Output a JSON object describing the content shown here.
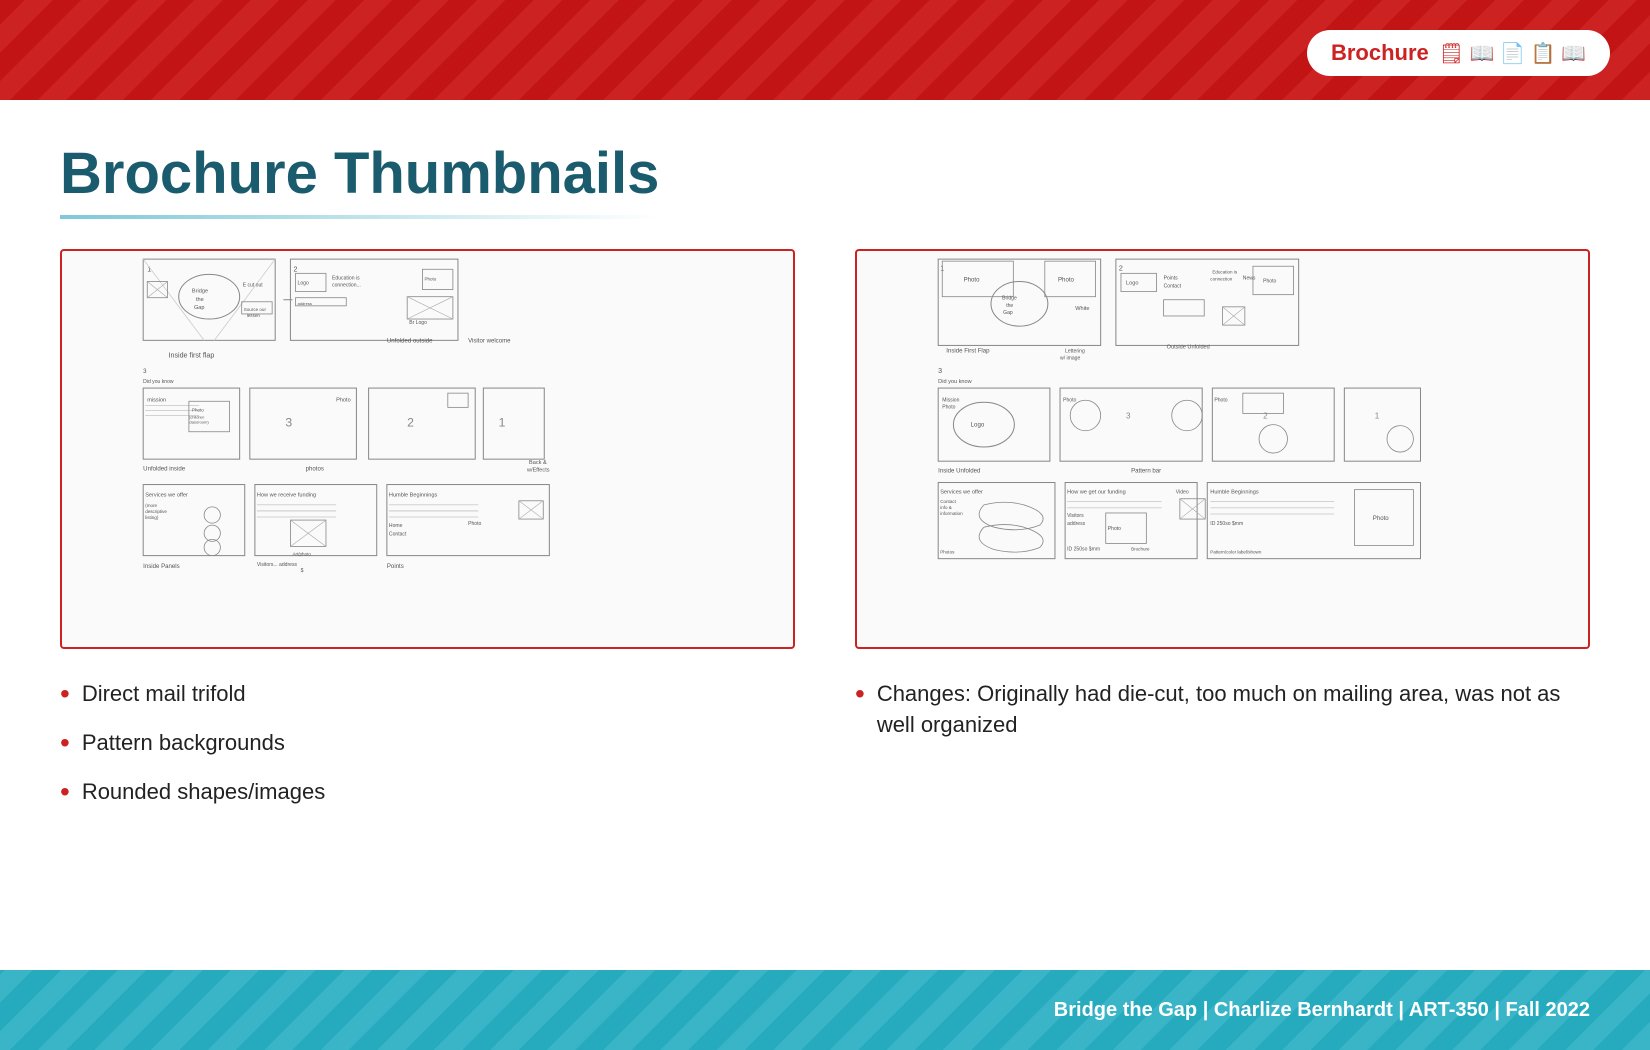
{
  "header": {
    "brochure_label": "Brochure",
    "icons": [
      "📋",
      "📖",
      "📄",
      "📋",
      "📖"
    ]
  },
  "page": {
    "title": "Brochure Thumbnails",
    "title_underline_color": "#7ec8d8"
  },
  "bullets_left": [
    "Direct mail trifold",
    "Pattern backgrounds",
    "Rounded shapes/images"
  ],
  "bullets_right_label": "Changes: Originally had die-cut, too much on mailing area, was not as well organized",
  "footer": {
    "text": "Bridge the Gap | Charlize Bernhardt | ART-350 | Fall 2022"
  }
}
